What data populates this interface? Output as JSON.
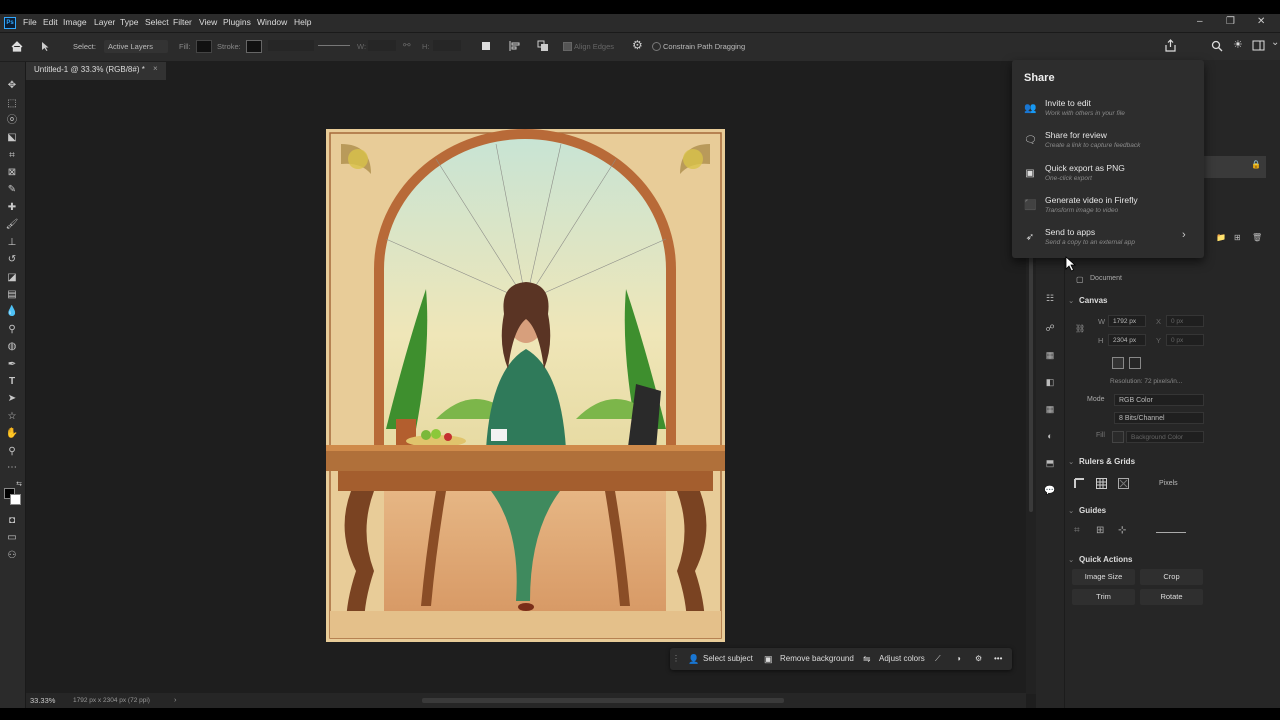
{
  "menubar": {
    "items": [
      "File",
      "Edit",
      "Image",
      "Layer",
      "Type",
      "Select",
      "Filter",
      "View",
      "Plugins",
      "Window",
      "Help"
    ],
    "app_icon": "Ps"
  },
  "window_controls": {
    "minimize": "–",
    "restore": "❐",
    "close": "✕"
  },
  "options_bar": {
    "select_label": "Select:",
    "select_value": "Active Layers",
    "fill_label": "Fill:",
    "stroke_label": "Stroke:",
    "w_label": "W:",
    "h_label": "H:",
    "align_edges": "Align Edges",
    "constrain": "Constrain Path Dragging"
  },
  "document_tab": {
    "title": "Untitled-1 @ 33.3% (RGB/8#) *",
    "close": "×"
  },
  "status": {
    "zoom": "33.33%",
    "info": "1792 px x 2304 px (72 ppi)",
    "arrow": "›"
  },
  "share_popup": {
    "title": "Share",
    "items": [
      {
        "icon": "invite-icon",
        "title": "Invite to edit",
        "subtitle": "Work with others in your file"
      },
      {
        "icon": "review-icon",
        "title": "Share for review",
        "subtitle": "Create a link to capture feedback"
      },
      {
        "icon": "export-png-icon",
        "title": "Quick export as PNG",
        "subtitle": "One-click export"
      },
      {
        "icon": "firefly-icon",
        "title": "Generate video in Firefly",
        "subtitle": "Transform image to video"
      },
      {
        "icon": "send-apps-icon",
        "title": "Send to apps",
        "subtitle": "Send a copy to an external app"
      }
    ],
    "chevron": "›"
  },
  "properties": {
    "document_label": "Document",
    "canvas": {
      "heading": "Canvas",
      "w_label": "W",
      "w_value": "1792 px",
      "x_label": "X",
      "x_value": "0 px",
      "h_label": "H",
      "h_value": "2304 px",
      "y_label": "Y",
      "y_value": "0 px",
      "resolution": "Resolution: 72 pixels/in...",
      "mode_label": "Mode",
      "mode_value": "RGB Color",
      "bits_value": "8 Bits/Channel",
      "fill_label": "Fill",
      "fill_value": "Background Color"
    },
    "rulers": {
      "heading": "Rulers & Grids",
      "units": "Pixels"
    },
    "guides": {
      "heading": "Guides"
    },
    "quick_actions": {
      "heading": "Quick Actions",
      "image_size": "Image Size",
      "crop": "Crop",
      "trim": "Trim",
      "rotate": "Rotate"
    }
  },
  "context_bar": {
    "select_subject": "Select subject",
    "remove_background": "Remove background",
    "adjust_colors": "Adjust colors",
    "more": "•••"
  },
  "colors": {
    "accent": "#31a8ff",
    "panel": "#262626",
    "canvas_bg": "#1e1e1e"
  }
}
